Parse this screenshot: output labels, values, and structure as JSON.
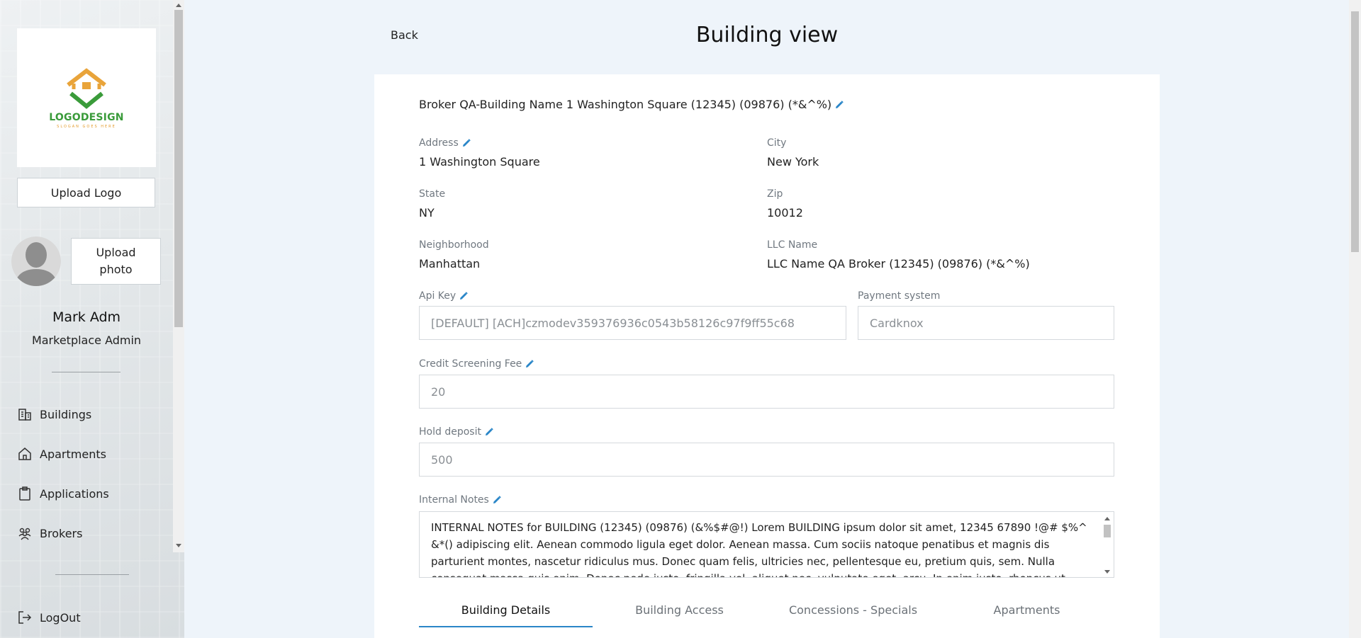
{
  "sidebar": {
    "logo": {
      "text": "LOGODESIGN",
      "tagline": "SLOGAN GOES HERE"
    },
    "upload_logo_label": "Upload Logo",
    "upload_photo_label": "Upload photo",
    "user": {
      "name": "Mark Adm",
      "role": "Marketplace Admin"
    },
    "nav": [
      {
        "label": "Buildings",
        "icon": "building-icon"
      },
      {
        "label": "Apartments",
        "icon": "home-icon"
      },
      {
        "label": "Applications",
        "icon": "clipboard-icon"
      },
      {
        "label": "Brokers",
        "icon": "users-icon"
      }
    ],
    "logout_label": "LogOut"
  },
  "header": {
    "back_label": "Back",
    "title": "Building view"
  },
  "building": {
    "name": "Broker QA-Building Name 1 Washington Square (12345) (09876) (*&^%)",
    "fields": {
      "address": {
        "label": "Address",
        "value": "1 Washington Square"
      },
      "city": {
        "label": "City",
        "value": "New York"
      },
      "state": {
        "label": "State",
        "value": "NY"
      },
      "zip": {
        "label": "Zip",
        "value": "10012"
      },
      "neighborhood": {
        "label": "Neighborhood",
        "value": "Manhattan"
      },
      "llc_name": {
        "label": "LLC Name",
        "value": "LLC Name QA Broker (12345) (09876) (*&^%)"
      }
    },
    "api_key": {
      "label": "Api Key",
      "value": "[DEFAULT] [ACH]czmodev359376936c0543b58126c97f9ff55c68"
    },
    "payment_system": {
      "label": "Payment system",
      "value": "Cardknox"
    },
    "credit_screening_fee": {
      "label": "Credit Screening Fee",
      "value": "20"
    },
    "hold_deposit": {
      "label": "Hold deposit",
      "value": "500"
    },
    "internal_notes": {
      "label": "Internal Notes",
      "value": "INTERNAL NOTES for BUILDING (12345) (09876) (&%$#@!) Lorem BUILDING ipsum dolor sit amet, 12345 67890 !@# $%^ &*() adipiscing elit. Aenean commodo ligula eget dolor. Aenean massa. Cum sociis natoque penatibus et magnis dis parturient montes, nascetur ridiculus mus. Donec quam felis, ultricies nec, pellentesque eu, pretium quis, sem. Nulla consequat massa quis enim. Donec pede justo, fringilla vel, aliquet nec, vulputate eget, arcu. In enim justo, rhoncus ut, imperdiet a, venenatis vitae, justo."
    }
  },
  "tabs": [
    {
      "label": "Building Details",
      "active": true
    },
    {
      "label": "Building Access",
      "active": false
    },
    {
      "label": "Concessions - Specials",
      "active": false
    },
    {
      "label": "Apartments",
      "active": false
    }
  ],
  "colors": {
    "accent": "#2a86c8",
    "logo_orange": "#e9a43a",
    "logo_green": "#3a9b3a"
  }
}
